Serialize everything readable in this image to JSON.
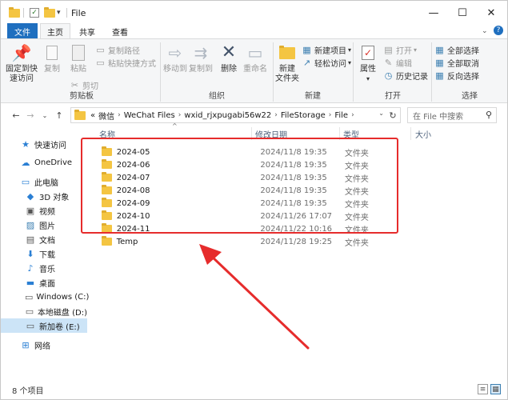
{
  "window": {
    "title": "File",
    "minimize": "—",
    "maximize": "☐",
    "close": "✕"
  },
  "ribbon": {
    "tabs": [
      {
        "label": "文件"
      },
      {
        "label": "主页"
      },
      {
        "label": "共享"
      },
      {
        "label": "查看"
      }
    ],
    "clipboard": {
      "pin_label_1": "固定到快",
      "pin_label_2": "速访问",
      "copy": "复制",
      "paste": "粘贴",
      "copy_path": "复制路径",
      "paste_shortcut": "粘贴快捷方式",
      "cut": "剪切",
      "group": "剪贴板"
    },
    "organize": {
      "move_to": "移动到",
      "copy_to": "复制到",
      "delete": "删除",
      "rename": "重命名",
      "group": "组织"
    },
    "new": {
      "new_item": "新建项目",
      "easy_access": "轻松访问",
      "new_folder_1": "新建",
      "new_folder_2": "文件夹",
      "group": "新建"
    },
    "open": {
      "properties": "属性",
      "open": "打开",
      "edit": "编辑",
      "history": "历史记录",
      "group": "打开"
    },
    "select": {
      "select_all": "全部选择",
      "select_none": "全部取消",
      "invert": "反向选择",
      "group": "选择"
    }
  },
  "address": {
    "overflow": "«",
    "crumbs": [
      "微信",
      "WeChat Files",
      "wxid_rjxpugabi56w22",
      "FileStorage",
      "File"
    ],
    "search_placeholder": "在 File 中搜索"
  },
  "columns": {
    "name": "名称",
    "date": "修改日期",
    "type": "类型",
    "size": "大小"
  },
  "files": [
    {
      "name": "2024-05",
      "date": "2024/11/8 19:35",
      "type": "文件夹"
    },
    {
      "name": "2024-06",
      "date": "2024/11/8 19:35",
      "type": "文件夹"
    },
    {
      "name": "2024-07",
      "date": "2024/11/8 19:35",
      "type": "文件夹"
    },
    {
      "name": "2024-08",
      "date": "2024/11/8 19:35",
      "type": "文件夹"
    },
    {
      "name": "2024-09",
      "date": "2024/11/8 19:35",
      "type": "文件夹"
    },
    {
      "name": "2024-10",
      "date": "2024/11/26 17:07",
      "type": "文件夹"
    },
    {
      "name": "2024-11",
      "date": "2024/11/22 10:16",
      "type": "文件夹"
    },
    {
      "name": "Temp",
      "date": "2024/11/28 19:25",
      "type": "文件夹"
    }
  ],
  "nav": [
    {
      "label": "快速访问",
      "icon": "star-icon"
    },
    {
      "label": "OneDrive",
      "icon": "cloud-icon"
    },
    {
      "label": "此电脑",
      "icon": "computer-icon"
    },
    {
      "label": "3D 对象",
      "icon": "cube-icon"
    },
    {
      "label": "视频",
      "icon": "video-icon"
    },
    {
      "label": "图片",
      "icon": "picture-icon"
    },
    {
      "label": "文档",
      "icon": "document-icon"
    },
    {
      "label": "下载",
      "icon": "download-icon"
    },
    {
      "label": "音乐",
      "icon": "music-icon"
    },
    {
      "label": "桌面",
      "icon": "desktop-icon"
    },
    {
      "label": "Windows (C:)",
      "icon": "drive-icon"
    },
    {
      "label": "本地磁盘 (D:)",
      "icon": "drive-icon"
    },
    {
      "label": "新加卷 (E:)",
      "icon": "drive-icon"
    },
    {
      "label": "网络",
      "icon": "network-icon"
    }
  ],
  "status": {
    "count": "8 个项目"
  },
  "colors": {
    "accent": "#1f6fbf",
    "folder": "#f4c542",
    "highlight": "#e62c2c",
    "selection": "#cce4f7"
  }
}
